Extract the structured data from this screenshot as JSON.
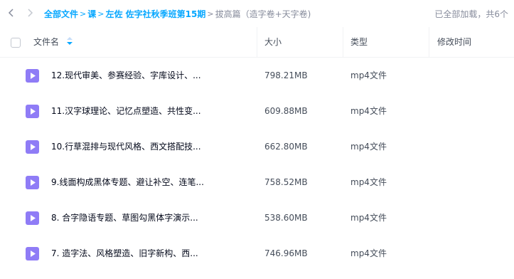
{
  "breadcrumb": {
    "items": [
      "全部文件",
      "课",
      "左佐 佐字社秋季班第15期"
    ],
    "current": "拔高篇（造字卷+天字卷)"
  },
  "status": {
    "text": "已全部加载，共6个"
  },
  "table": {
    "columns": [
      "文件名",
      "大小",
      "类型",
      "修改时间"
    ],
    "rows": [
      {
        "name": "12.现代审美、参赛经验、字库设计、...",
        "size": "798.21MB",
        "type": "mp4文件",
        "mtime": ""
      },
      {
        "name": "11.汉字球理论、记忆点塑造、共性变...",
        "size": "609.88MB",
        "type": "mp4文件",
        "mtime": ""
      },
      {
        "name": "10.行草混排与现代风格、西文搭配技...",
        "size": "662.80MB",
        "type": "mp4文件",
        "mtime": ""
      },
      {
        "name": "9.线面构成黑体专题、避让补空、连笔...",
        "size": "758.52MB",
        "type": "mp4文件",
        "mtime": ""
      },
      {
        "name": "8. 合字隐语专题、草图勾黑体字演示...",
        "size": "538.60MB",
        "type": "mp4文件",
        "mtime": ""
      },
      {
        "name": "7. 造字法、风格塑造、旧字新构、西...",
        "size": "746.96MB",
        "type": "mp4文件",
        "mtime": ""
      }
    ]
  },
  "icons": {
    "back": "chevron-left-icon",
    "forward": "chevron-right-icon",
    "sort": "sort-icon",
    "file": "video-file-icon"
  },
  "colors": {
    "accent": "#06a7ff",
    "file_icon": "#8f7cf6",
    "muted_text": "#878c9c"
  }
}
